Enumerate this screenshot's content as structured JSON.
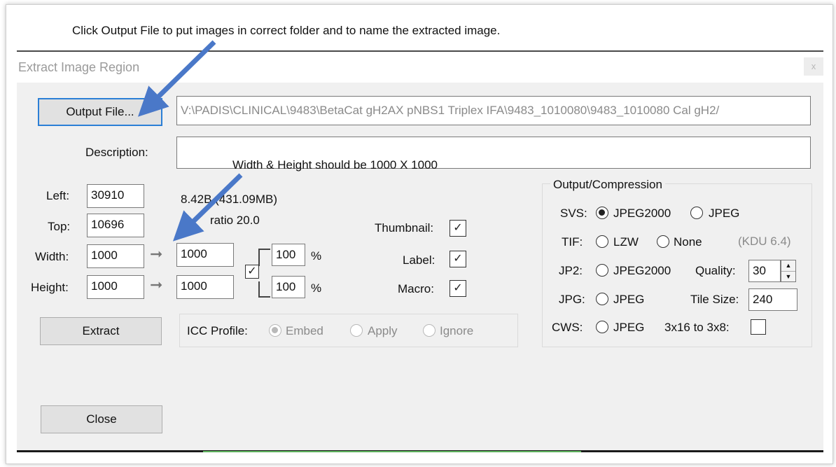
{
  "annotations": {
    "top_note": "Click Output File to put images in correct folder and to name the extracted image.",
    "size_note": "Width & Height should be 1000 X 1000"
  },
  "window": {
    "title": "Extract Image Region",
    "close_glyph": "x"
  },
  "output": {
    "button_label": "Output File...",
    "path": "V:\\PADIS\\CLINICAL\\9483\\BetaCat gH2AX pNBS1 Triplex IFA\\9483_1010080\\9483_1010080 Cal gH2/"
  },
  "description": {
    "label": "Description:",
    "value": ""
  },
  "region": {
    "left_label": "Left:",
    "left_value": "30910",
    "top_label": "Top:",
    "top_value": "10696",
    "width_label": "Width:",
    "width_value": "1000",
    "height_label": "Height:",
    "height_value": "1000",
    "out_width": "1000",
    "out_height": "1000",
    "width_pct": "100",
    "height_pct": "100",
    "pct_symbol": "%",
    "size_info": "8.42",
    "size_info_rest": "B (431.09MB)",
    "ratio": "ratio 20.0"
  },
  "options": {
    "thumbnail_label": "Thumbnail:",
    "label_label": "Label:",
    "macro_label": "Macro:",
    "check_glyph": "✓"
  },
  "extract_button": "Extract",
  "icc": {
    "label": "ICC Profile:",
    "embed": "Embed",
    "apply": "Apply",
    "ignore": "Ignore"
  },
  "compression": {
    "group_label": "Output/Compression",
    "svs_label": "SVS:",
    "svs_opt1": "JPEG2000",
    "svs_opt2": "JPEG",
    "tif_label": "TIF:",
    "tif_opt1": "LZW",
    "tif_opt2": "None",
    "kdu": "(KDU 6.4)",
    "jp2_label": "JP2:",
    "jp2_opt1": "JPEG2000",
    "quality_label": "Quality:",
    "quality_value": "30",
    "jpg_label": "JPG:",
    "jpg_opt1": "JPEG",
    "tile_label": "Tile Size:",
    "tile_value": "240",
    "cws_label": "CWS:",
    "cws_opt1": "JPEG",
    "x3_label": "3x16 to 3x8:"
  },
  "close_button": "Close",
  "colors": {
    "annotation_arrow": "#4a78c8",
    "focus_border": "#2b7fd6",
    "dialog_bg": "#f0f0f0"
  }
}
